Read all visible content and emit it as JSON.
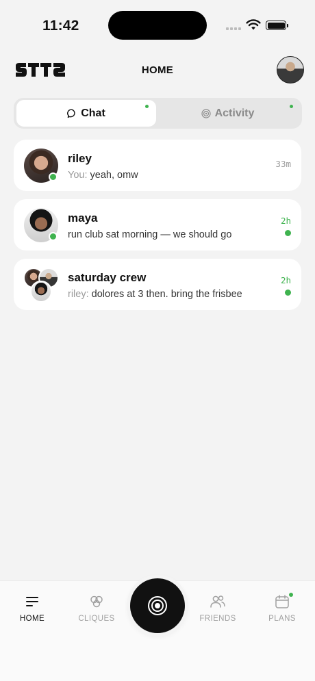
{
  "status_bar": {
    "time": "11:42"
  },
  "header": {
    "title": "HOME",
    "logo": "sttz-logo",
    "profile_icon": "profile-avatar"
  },
  "tabs": [
    {
      "label": "Chat",
      "icon": "chat-bubble-icon",
      "active": true,
      "has_dot": true
    },
    {
      "label": "Activity",
      "icon": "radar-icon",
      "active": false,
      "has_dot": true
    }
  ],
  "conversations": [
    {
      "name": "riley",
      "prefix": "You:",
      "message": "yeah, omw",
      "time": "33m",
      "unread": false,
      "online": true
    },
    {
      "name": "maya",
      "prefix": "",
      "message": "run club sat morning — we should go",
      "time": "2h",
      "unread": true,
      "online": true
    },
    {
      "name": "saturday crew",
      "prefix": "riley:",
      "message": "dolores at 3 then. bring the frisbee",
      "time": "2h",
      "unread": true,
      "online": false
    }
  ],
  "nav": {
    "home": "HOME",
    "cliques": "CLIQUES",
    "friends": "FRIENDS",
    "plans": "PLANS",
    "center_icon": "record-target-icon"
  },
  "colors": {
    "accent_green": "#3fb34f",
    "background": "#f3f3f3",
    "card": "#ffffff",
    "dark": "#111111"
  }
}
